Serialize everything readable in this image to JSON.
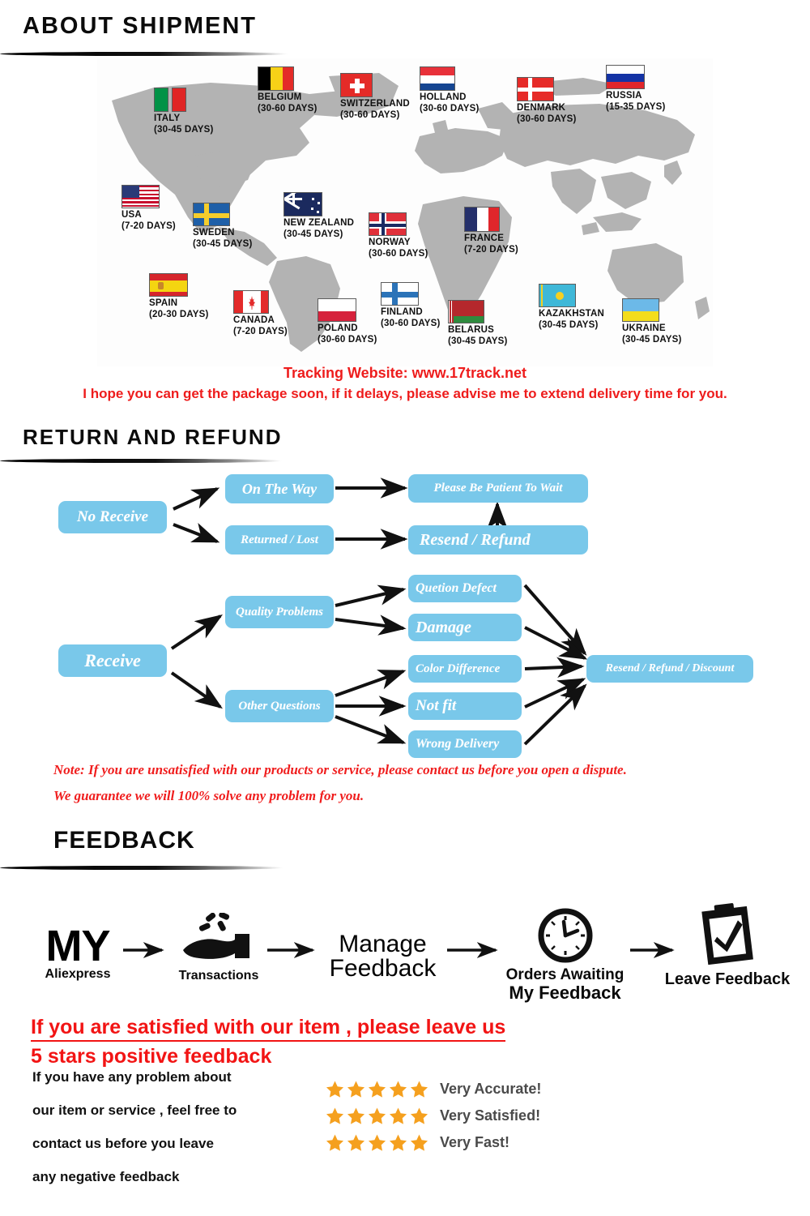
{
  "sections": {
    "shipment": {
      "title": "ABOUT  SHIPMENT"
    },
    "return": {
      "title": "RETURN  AND  REFUND"
    },
    "feedback": {
      "title": "FEEDBACK"
    }
  },
  "map": {
    "countries": [
      {
        "name": "ITALY",
        "days": "(30-45 DAYS)"
      },
      {
        "name": "BELGIUM",
        "days": "(30-60 DAYS)"
      },
      {
        "name": "SWITZERLAND",
        "days": "(30-60 DAYS)"
      },
      {
        "name": "HOLLAND",
        "days": "(30-60 DAYS)"
      },
      {
        "name": "DENMARK",
        "days": "(30-60 DAYS)"
      },
      {
        "name": "RUSSIA",
        "days": "(15-35 DAYS)"
      },
      {
        "name": "USA",
        "days": "(7-20 DAYS)"
      },
      {
        "name": "SWEDEN",
        "days": "(30-45 DAYS)"
      },
      {
        "name": "NEW ZEALAND",
        "days": "(30-45 DAYS)"
      },
      {
        "name": "NORWAY",
        "days": "(30-60 DAYS)"
      },
      {
        "name": "FRANCE",
        "days": "(7-20 DAYS)"
      },
      {
        "name": "SPAIN",
        "days": "(20-30 DAYS)"
      },
      {
        "name": "CANADA",
        "days": "(7-20 DAYS)"
      },
      {
        "name": "POLAND",
        "days": "(30-60 DAYS)"
      },
      {
        "name": "FINLAND",
        "days": "(30-60 DAYS)"
      },
      {
        "name": "BELARUS",
        "days": "(30-45 DAYS)"
      },
      {
        "name": "KAZAKHSTAN",
        "days": "(30-45 DAYS)"
      },
      {
        "name": "UKRAINE",
        "days": "(30-45 DAYS)"
      }
    ],
    "tracking_line": "Tracking Website: www.17track.net",
    "delay_line": "I hope you can get the package soon, if it delays, please advise me to extend delivery time for you."
  },
  "flowchart": {
    "no_receive": "No Receive",
    "on_the_way": "On The Way",
    "returned_lost": "Returned / Lost",
    "be_patient": "Please Be Patient To Wait",
    "resend_refund": "Resend / Refund",
    "receive": "Receive",
    "quality_problems": "Quality Problems",
    "other_questions": "Other Questions",
    "quetion_defect": "Quetion Defect",
    "damage": "Damage",
    "color_difference": "Color Difference",
    "not_fit": "Not fit",
    "wrong_delivery": "Wrong Delivery",
    "resend_refund_discount": "Resend / Refund / Discount",
    "note_line_1": "Note: If you are unsatisfied with our products or service, please contact us before you open a dispute.",
    "note_line_2": "We guarantee we will 100% solve any problem for you."
  },
  "feedback_flow": {
    "step1_word": "MY",
    "step1_label": "Aliexpress",
    "step2_label": "Transactions",
    "step3_line1": "Manage",
    "step3_line2": "Feedback",
    "step4_line1": "Orders Awaiting",
    "step4_line2": "My Feedback",
    "step5_label": "Leave Feedback"
  },
  "bottom": {
    "headline_1": "If you are satisfied with our item , please leave us",
    "headline_2": "5 stars positive feedback",
    "body": [
      "If you have any problem about",
      "our item or service , feel free to",
      "contact us before you  leave",
      "any negative feedback"
    ],
    "ratings": [
      {
        "stars": 5,
        "text": "Very Accurate!"
      },
      {
        "stars": 5,
        "text": "Very Satisfied!"
      },
      {
        "stars": 5,
        "text": "Very Fast!"
      }
    ]
  },
  "colors": {
    "accent_blue": "#79c8ea",
    "red": "#ee1c1c",
    "star_orange": "#f5a01e",
    "map_gray": "#b3b3b3"
  }
}
